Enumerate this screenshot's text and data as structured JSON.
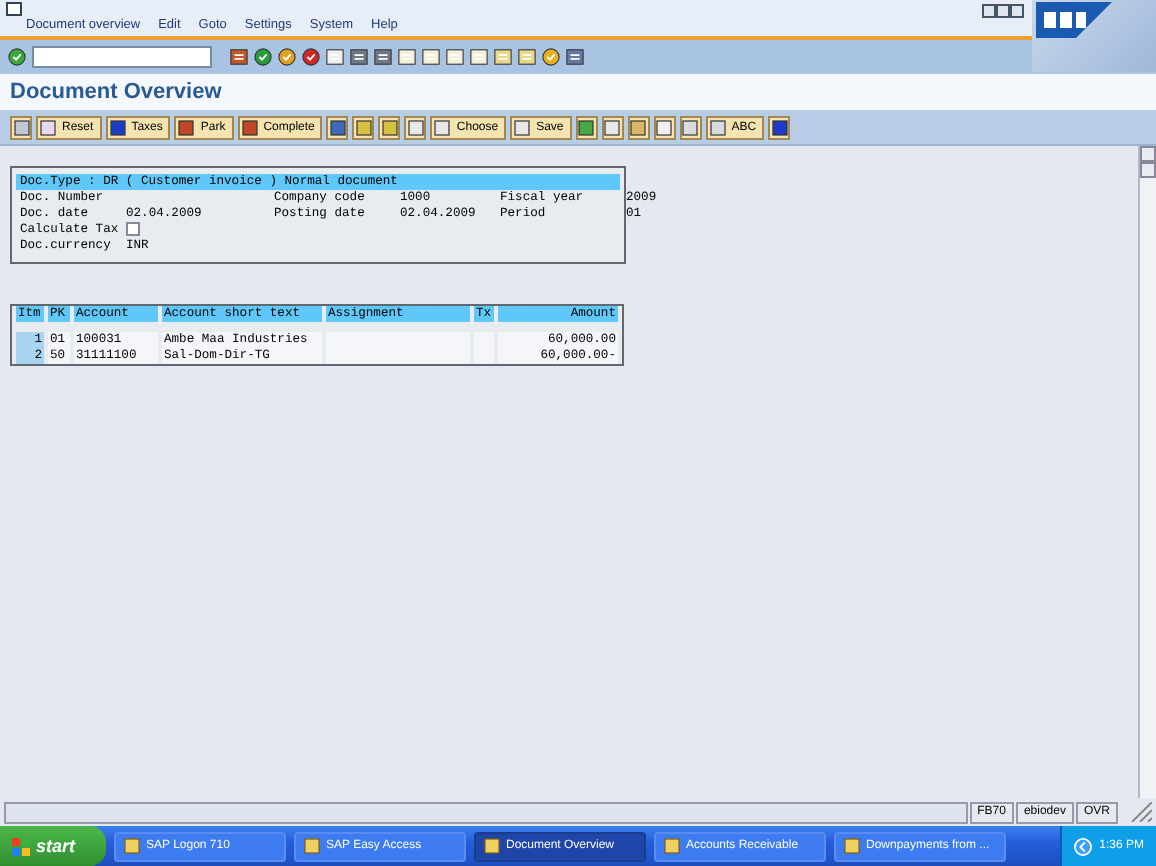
{
  "menu": [
    "Document overview",
    "Edit",
    "Goto",
    "Settings",
    "System",
    "Help"
  ],
  "title": "Document Overview",
  "app_toolbar": [
    {
      "kind": "icon"
    },
    {
      "kind": "labeled",
      "label": "Reset"
    },
    {
      "kind": "labeled",
      "label": "Taxes"
    },
    {
      "kind": "labeled",
      "label": "Park"
    },
    {
      "kind": "labeled",
      "label": "Complete"
    },
    {
      "kind": "icon"
    },
    {
      "kind": "icon"
    },
    {
      "kind": "icon"
    },
    {
      "kind": "icon"
    },
    {
      "kind": "labeled",
      "label": "Choose"
    },
    {
      "kind": "labeled",
      "label": "Save"
    },
    {
      "kind": "icon"
    },
    {
      "kind": "icon"
    },
    {
      "kind": "icon"
    },
    {
      "kind": "icon"
    },
    {
      "kind": "icon"
    },
    {
      "kind": "labeled",
      "label": "ABC"
    },
    {
      "kind": "icon"
    }
  ],
  "header": {
    "doc_type": "Doc.Type : DR ( Customer invoice ) Normal document",
    "rows": [
      [
        {
          "label": "Doc. Number"
        },
        {
          "label": "Company code",
          "value": "1000"
        },
        {
          "label": "Fiscal year",
          "value": "2009"
        }
      ],
      [
        {
          "label": "Doc. date",
          "value": "02.04.2009"
        },
        {
          "label": "Posting date",
          "value": "02.04.2009"
        },
        {
          "label": "Period",
          "value": "01"
        }
      ]
    ],
    "calculate_tax": {
      "label": "Calculate Tax",
      "checked": false
    },
    "currency": {
      "label": "Doc.currency",
      "value": "INR"
    }
  },
  "table": {
    "columns": [
      "Itm",
      "PK",
      "Account",
      "Account short text",
      "Assignment",
      "Tx",
      "Amount"
    ],
    "rows": [
      {
        "item": "1",
        "pk": "01",
        "account": "100031",
        "short_text": "Ambe Maa Industries",
        "amount": "60,000.00"
      },
      {
        "item": "2",
        "pk": "50",
        "account": "31111100",
        "short_text": "Sal-Dom-Dir-TG",
        "amount": "60,000.00-"
      }
    ]
  },
  "status_bar": {
    "transaction": "FB70",
    "user": "ebiodev",
    "mode": "OVR"
  },
  "taskbar": {
    "start": "start",
    "tasks": [
      {
        "label": "SAP Logon 710",
        "selected": false
      },
      {
        "label": "SAP Easy Access",
        "selected": false
      },
      {
        "label": "Document Overview",
        "selected": true
      },
      {
        "label": "Accounts Receivable",
        "selected": false
      },
      {
        "label": "Downpayments from ...",
        "selected": false
      }
    ],
    "clock": "1:36 PM"
  }
}
